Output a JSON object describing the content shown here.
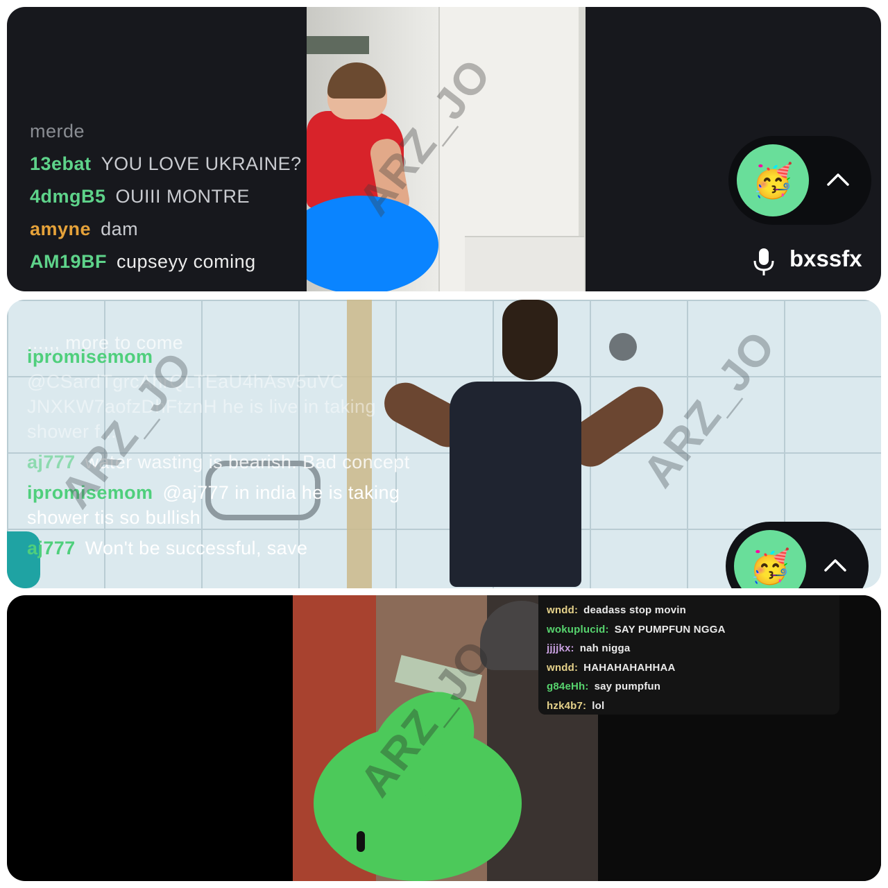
{
  "watermark": "ARZ_JO",
  "panel1": {
    "chat": [
      {
        "user": "",
        "text": "merde"
      },
      {
        "user": "13ebat",
        "text": "YOU LOVE UKRAINE?",
        "color": "#5ed38a"
      },
      {
        "user": "4dmgB5",
        "text": "OUIII MONTRE",
        "color": "#5ed38a"
      },
      {
        "user": "amyne",
        "text": "dam",
        "color": "#e5a23a"
      },
      {
        "user": "AM19BF",
        "text": "cupseyy coming",
        "color": "#5ed38a"
      }
    ],
    "reaction_emoji": "🥳",
    "expand_icon": "chevron-up-icon",
    "mic_icon": "microphone-icon",
    "streamer": "bxssfx"
  },
  "panel2": {
    "top_line": "...,,, more to come",
    "chat": [
      {
        "user": "ipromisemom",
        "text": "@CSardTgrcAhrQLTEaU4hAsv5uVC JNXKW7aofzDhFtznH he is live in taking shower f..."
      },
      {
        "user": "aj777",
        "text": "water wasting is bearish. Bad concept"
      },
      {
        "user": "ipromisemom",
        "text": "@aj777 in india he is taking shower tis so bullish"
      },
      {
        "user": "aj777",
        "text": "Won't be successful, save"
      }
    ],
    "reaction_emoji": "🥳",
    "expand_icon": "chevron-up-icon"
  },
  "panel3": {
    "chat": [
      {
        "user": "wndd:",
        "text": "deadass stop movin",
        "color": "#e6d28a"
      },
      {
        "user": "wokuplucid:",
        "text": "SAY PUMPFUN NGGA",
        "color": "#57d46e"
      },
      {
        "user": "jjjjkx:",
        "text": "nah nigga",
        "color": "#c8a0e0"
      },
      {
        "user": "wndd:",
        "text": "HAHAHAHAHHAA",
        "color": "#e6d28a"
      },
      {
        "user": "g84eHh:",
        "text": "say pumpfun",
        "color": "#57d46e"
      },
      {
        "user": "hzk4b7:",
        "text": "lol",
        "color": "#e6d28a"
      }
    ]
  }
}
